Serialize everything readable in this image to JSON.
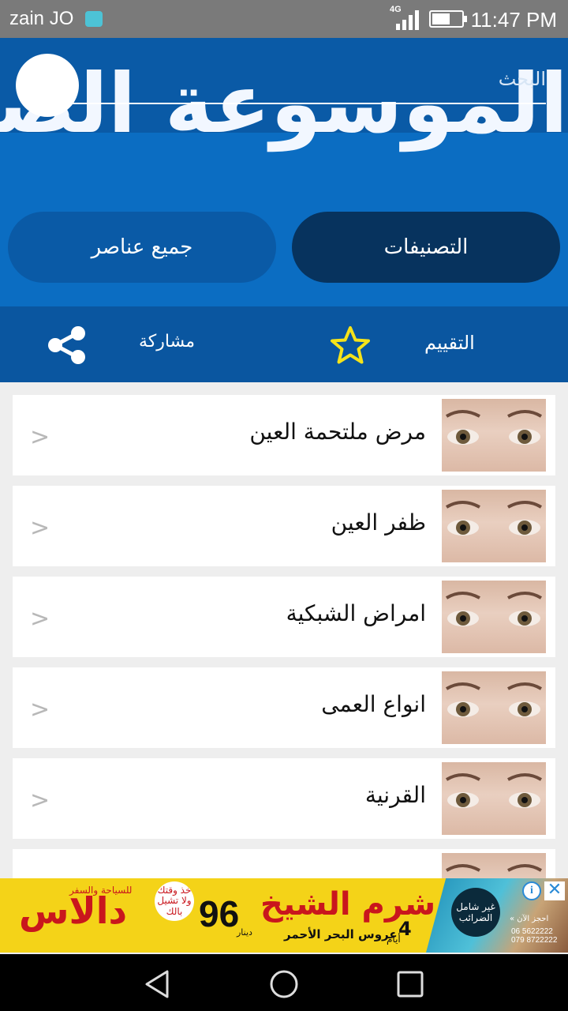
{
  "status_bar": {
    "carrier": "zain JO",
    "network": "4G",
    "time": "11:47 PM",
    "battery_level": 0.6
  },
  "header": {
    "app_title": "الموسوعة الصحية",
    "search_placeholder": "البحث",
    "tabs": [
      {
        "label": "التصنيفات",
        "active": true
      },
      {
        "label": "جميع عناصر",
        "active": false
      }
    ]
  },
  "actions": {
    "rate_label": "التقييم",
    "share_label": "مشاركة",
    "star_color": "#f5e31a"
  },
  "list": {
    "items": [
      {
        "title": "مرض ملتحمة العين",
        "chevron": ">",
        "thumb_icon": "eyes-image"
      },
      {
        "title": "ظفر العين",
        "chevron": ">",
        "thumb_icon": "eyes-image"
      },
      {
        "title": "امراض الشبكية",
        "chevron": ">",
        "thumb_icon": "eyes-image"
      },
      {
        "title": "انواع العمى",
        "chevron": ">",
        "thumb_icon": "eyes-image"
      },
      {
        "title": "القرنية",
        "chevron": ">",
        "thumb_icon": "eyes-image"
      }
    ]
  },
  "ad": {
    "brand": "دالاس",
    "brand_tagline": "للسياحة والسفر",
    "price_note": "خذ وقتك ولا تشيل بالك",
    "price": "96",
    "price_unit": "دينار",
    "headline": "شرم الشيخ",
    "subline": "عروس البحر الأحمر",
    "days": "4",
    "days_unit": "أيام",
    "badge": "غير شامل الضرائب",
    "book_now": "احجز الآن »",
    "phones": [
      "06 5622222",
      "079 8722222"
    ]
  },
  "colors": {
    "header_blue": "#0b6dc2",
    "active_tab": "#07335e",
    "action_bar": "#0a56a0",
    "ad_yellow": "#f4d318",
    "ad_red": "#c9161d"
  }
}
